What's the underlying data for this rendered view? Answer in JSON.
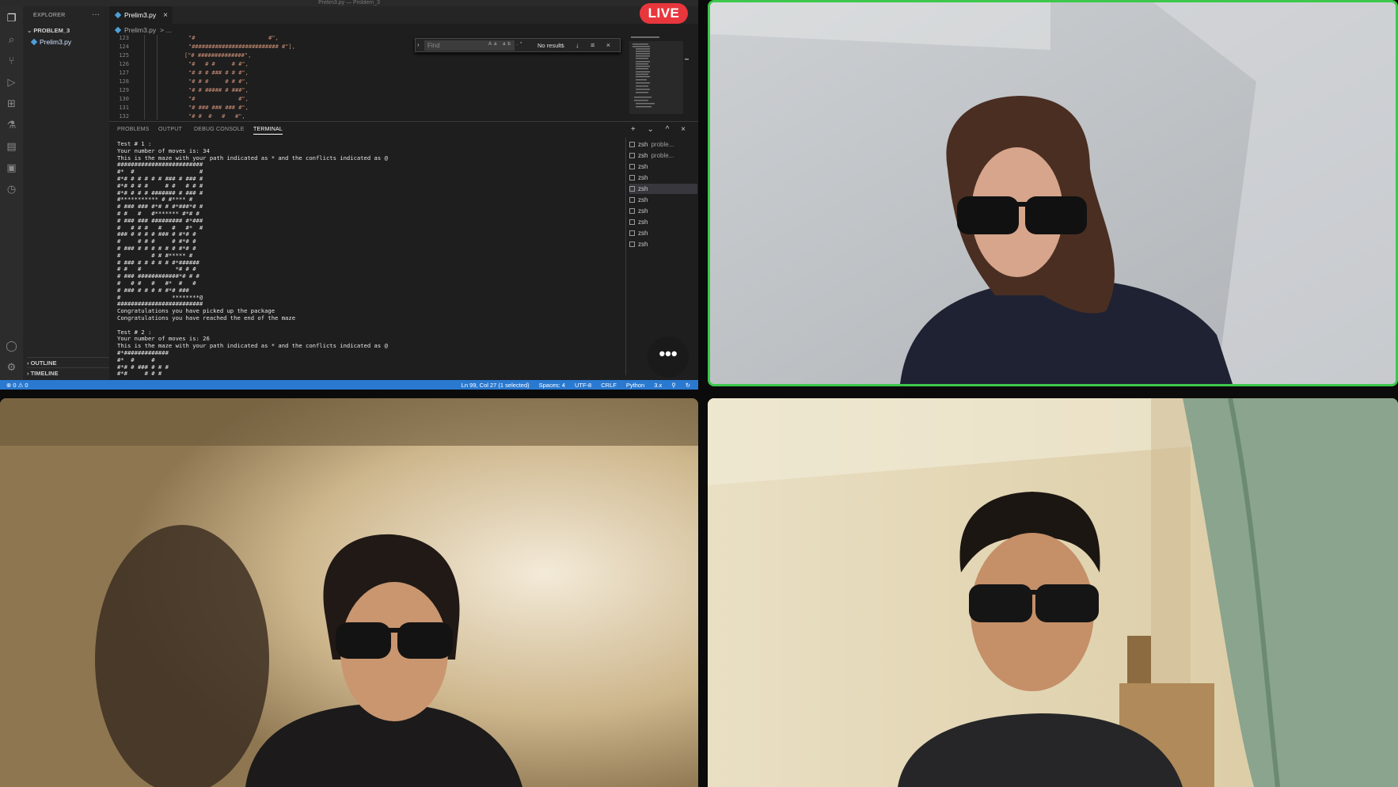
{
  "meeting": {
    "live_badge": "LIVE",
    "more_button": "•••",
    "participants": [
      {
        "tile": "top-right",
        "active_speaker": true,
        "highlight_color": "#3cc84b"
      },
      {
        "tile": "bottom-left",
        "active_speaker": false
      },
      {
        "tile": "bottom-right",
        "active_speaker": false
      }
    ]
  },
  "vscode": {
    "window_title": "Prelim3.py — Problem_3",
    "sidebar": {
      "header": "EXPLORER",
      "menu": "···",
      "folder": "PROBLEM_3",
      "file": "Prelim3.py",
      "outline": "OUTLINE",
      "timeline": "TIMELINE"
    },
    "tab": {
      "label": "Prelim3.py",
      "close": "×"
    },
    "breadcrumb": {
      "file": "Prelim3.py",
      "sep": "> ..."
    },
    "find": {
      "placeholder": "Find",
      "options": "Aa ab .*",
      "result": "No results",
      "buttons": "↑ ↓ ≡ ×"
    },
    "code_lines": [
      {
        "n": "123",
        "text": "\"#                      #\","
      },
      {
        "n": "124",
        "text": "\"########################## #\"],"
      },
      {
        "n": "125",
        "text": "[\"# ##############\","
      },
      {
        "n": "126",
        "text": "\"#   # #     # #\","
      },
      {
        "n": "127",
        "text": "\"# # # ### # # #\","
      },
      {
        "n": "128",
        "text": "\"# # #     # # #\","
      },
      {
        "n": "129",
        "text": "\"# # ##### # ###\","
      },
      {
        "n": "130",
        "text": "\"#             #\","
      },
      {
        "n": "131",
        "text": "\"# ### ### ### #\","
      },
      {
        "n": "132",
        "text": "\"# #  #   #   #\","
      }
    ],
    "panel_tabs": [
      "PROBLEMS",
      "OUTPUT",
      "DEBUG CONSOLE",
      "TERMINAL"
    ],
    "panel_actions": "+ ⌄ ^ ×",
    "terminal_output": "Test # 1 :\nYour number of moves is: 34\nThis is the maze with your path indicated as * and the conflicts indicated as @\n#########################\n#*  #                   #\n#*# # # # # # ### # ### #\n#*# # # #     # #   # # #\n#*# # # # ####### # ### #\n#*********** # #**** #\n# ### ### #*# # #*###*# #\n# #   #   #******* #*# #\n# ### ### ######### #*###\n#   # # #   #   #   #*  #\n### # # # # ### # #*# #\n#     # # #     # #*# #\n# ### # # # # # # #*# #\n#         # # #***** #\n# ### # # # # # #*######\n# #   #          *# # #\n# ### ############*# # #\n#   # #   #   #*  #   #\n# ### # # # # #*# ###\n#               ********@\n#########################\nCongratulations you have picked up the package\nCongratulations you have reached the end of the maze\n\nTest # 2 :\nYour number of moves is: 26\nThis is the maze with your path indicated as * and the conflicts indicated as @\n#*#############\n#*  #     #\n#*# # ### # # #\n#*#     # # #",
    "terminals": [
      {
        "label": "zsh",
        "extra": "proble...",
        "selected": false
      },
      {
        "label": "zsh",
        "extra": "proble...",
        "selected": false
      },
      {
        "label": "zsh",
        "extra": "",
        "selected": false
      },
      {
        "label": "zsh",
        "extra": "",
        "selected": false
      },
      {
        "label": "zsh",
        "extra": "",
        "selected": true
      },
      {
        "label": "zsh",
        "extra": "",
        "selected": false
      },
      {
        "label": "zsh",
        "extra": "",
        "selected": false
      },
      {
        "label": "zsh",
        "extra": "",
        "selected": false
      },
      {
        "label": "zsh",
        "extra": "",
        "selected": false
      },
      {
        "label": "zsh",
        "extra": "",
        "selected": false
      }
    ],
    "status": {
      "problems": "⊗ 0 ⚠ 0",
      "cursor": "Ln 99, Col 27 (1 selected)",
      "spaces": "Spaces: 4",
      "encoding": "UTF-8",
      "eol": "CRLF",
      "language": "Python",
      "version": "3.x",
      "feedback": "⚲",
      "sync": "↻"
    }
  }
}
